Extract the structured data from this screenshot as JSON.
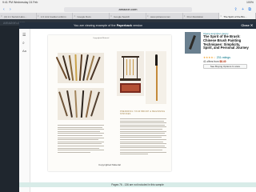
{
  "status": {
    "time": "9:41 PM  Wednesday 24 Feb",
    "battery": "100%"
  },
  "browser": {
    "back": "‹",
    "forward": "›",
    "aa": "AA",
    "url": "amazon.com",
    "tabs": [
      "(4) 1.1 Suzuki Haru...",
      "1.6 mini booklet uniform",
      "Google Docs",
      "Google Search",
      "www.pinterest.com",
      "Firor illustration",
      "The Spirit of the Bru..."
    ]
  },
  "amazon": {
    "logo": "amazon.com"
  },
  "look_inside": {
    "banner": "You are viewing example of the",
    "banner_bold": "Paperback",
    "banner_end": "version",
    "close": "Close ✕",
    "rail_icons": [
      "menu-icon",
      "search-icon",
      "font-icon"
    ],
    "page_label": "Copyrighted Material",
    "section_heading": "PREPARING YOUR BRUSH & BEGINNING STROKES",
    "copyright_mark": "Copyrighted Material",
    "footer_note": "Pages 76 - 136 are not included in this sample"
  },
  "product": {
    "author": "Cheng and Chen Jenny",
    "title": "The Spirit of the Brush: Chinese Brush Painting Techniques: Simplicity, Spirit, and Personal Journey",
    "stars": "★★★★☆",
    "ratings": "231 ratings",
    "offers_prefix": "41 offers from",
    "price": "$8.40",
    "button": "See Buying Options In store"
  },
  "colors": {
    "banner": "#232f3e",
    "link": "#007185",
    "price": "#b12704"
  }
}
